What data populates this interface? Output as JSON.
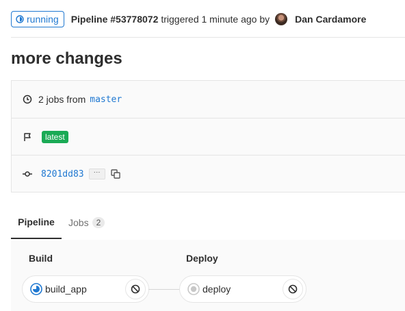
{
  "header": {
    "status_label": "running",
    "pipeline_title": "Pipeline #53778072",
    "triggered_text": "triggered 1 minute ago by",
    "author_name": "Dan Cardamore"
  },
  "page": {
    "title": "more changes"
  },
  "info": {
    "jobs_text": "2 jobs from",
    "branch": "master",
    "tag_label": "latest",
    "commit_sha": "8201dd83",
    "ellipsis_label": "···"
  },
  "tabs": [
    {
      "label": "Pipeline",
      "active": true
    },
    {
      "label": "Jobs",
      "count": "2",
      "active": false
    }
  ],
  "stages": [
    {
      "title": "Build",
      "jobs": [
        {
          "name": "build_app",
          "status": "running",
          "action": "cancel"
        }
      ]
    },
    {
      "title": "Deploy",
      "jobs": [
        {
          "name": "deploy",
          "status": "created",
          "action": "cancel"
        }
      ]
    }
  ],
  "colors": {
    "link": "#1f78d1",
    "success": "#1aaa55",
    "border": "#e5e5e5"
  }
}
